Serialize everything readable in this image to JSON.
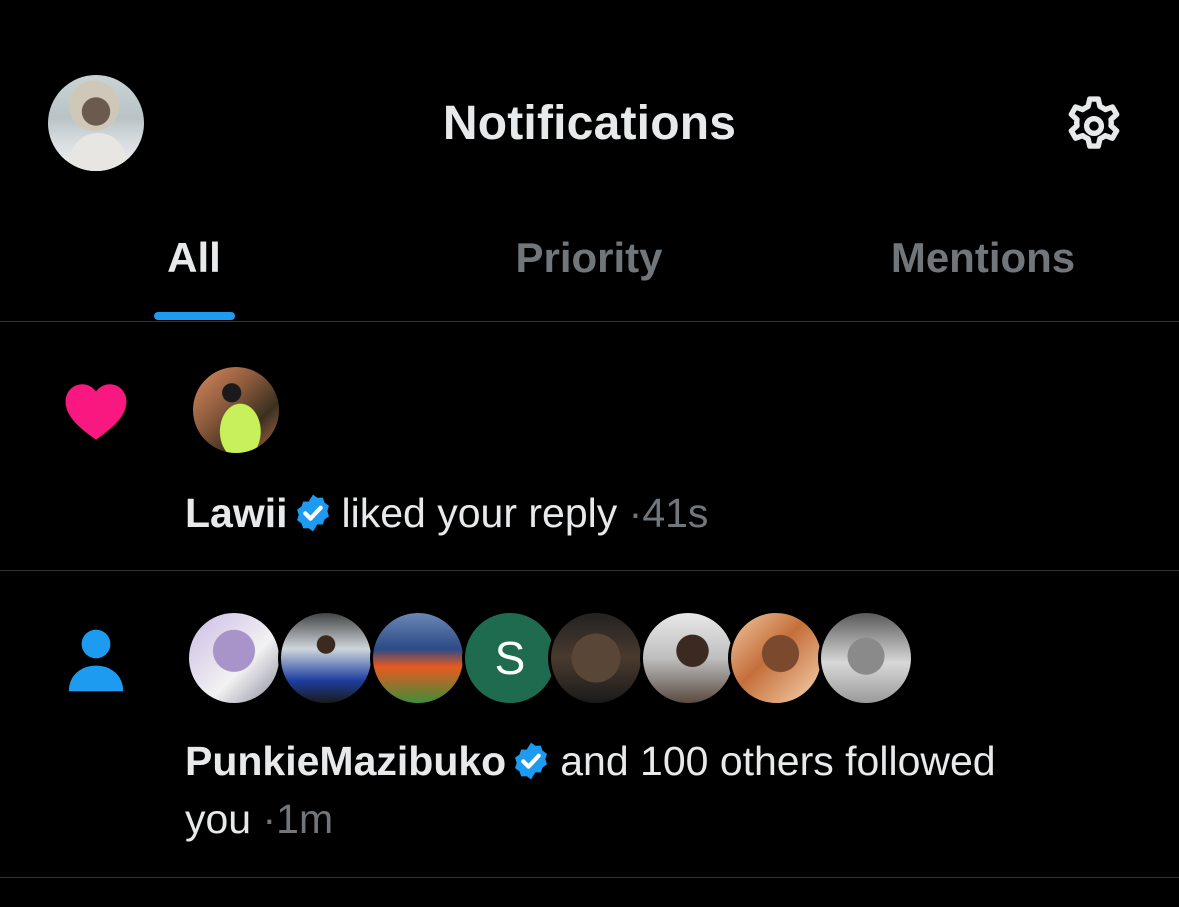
{
  "header": {
    "title": "Notifications",
    "avatar_icon": "user-avatar",
    "settings_icon": "gear-icon"
  },
  "tabs": [
    {
      "label": "All",
      "active": true
    },
    {
      "label": "Priority",
      "active": false
    },
    {
      "label": "Mentions",
      "active": false
    }
  ],
  "accent_color": "#1d9bf0",
  "notifications": [
    {
      "type": "like",
      "icon": "heart-icon",
      "icon_color": "#f91880",
      "user": "Lawii",
      "verified": true,
      "action": "liked your reply",
      "separator": "·",
      "time": "41s"
    },
    {
      "type": "follow",
      "icon": "person-icon",
      "icon_color": "#1d9bf0",
      "user": "PunkieMazibuko",
      "verified": true,
      "action_line1": "and 100 others followed",
      "action_line2": "you",
      "separator": "·",
      "time": "1m",
      "avatar_letter": "S"
    }
  ]
}
